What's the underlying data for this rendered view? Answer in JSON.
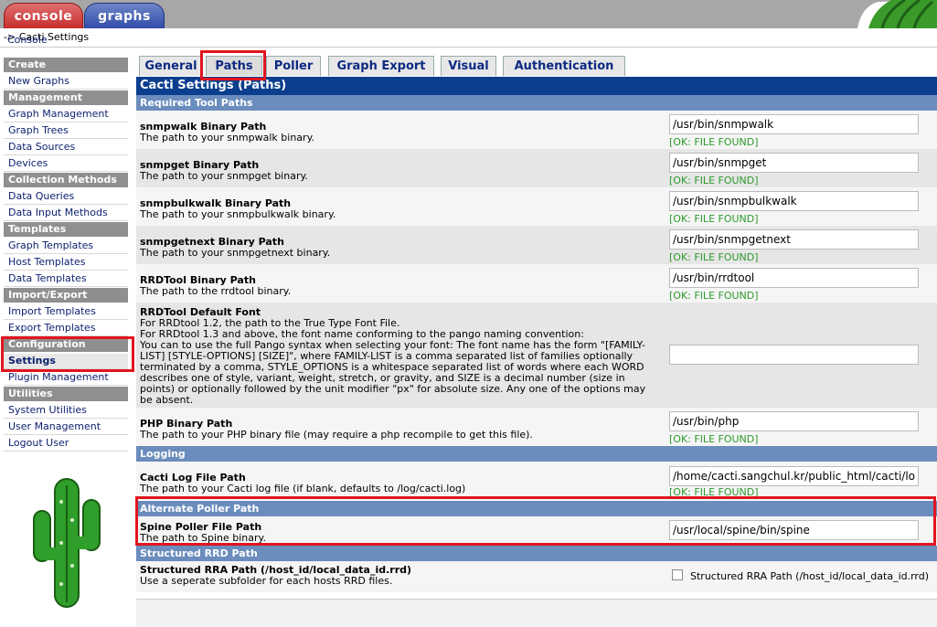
{
  "top_tabs": {
    "console": "console",
    "graphs": "graphs"
  },
  "breadcrumb": {
    "console_link": "Console",
    "separator": " -> ",
    "current": "Cacti Settings"
  },
  "sidebar": {
    "create_head": "Create",
    "new_graphs": "New Graphs",
    "management_head": "Management",
    "graph_management": "Graph Management",
    "graph_trees": "Graph Trees",
    "data_sources": "Data Sources",
    "devices": "Devices",
    "collection_head": "Collection Methods",
    "data_queries": "Data Queries",
    "data_input_methods": "Data Input Methods",
    "templates_head": "Templates",
    "graph_templates": "Graph Templates",
    "host_templates": "Host Templates",
    "data_templates": "Data Templates",
    "import_export_head": "Import/Export",
    "import_templates": "Import Templates",
    "export_templates": "Export Templates",
    "configuration_head": "Configuration",
    "settings": "Settings",
    "plugin_management": "Plugin Management",
    "utilities_head": "Utilities",
    "system_utilities": "System Utilities",
    "user_management": "User Management",
    "logout_user": "Logout User"
  },
  "tabs": {
    "general": "General",
    "paths": "Paths",
    "poller": "Poller",
    "graph_export": "Graph Export",
    "visual": "Visual",
    "authentication": "Authentication"
  },
  "title": "Cacti Settings (Paths)",
  "sections": {
    "required": "Required Tool Paths",
    "logging": "Logging",
    "alternate": "Alternate Poller Path",
    "structured": "Structured RRD Path"
  },
  "ok_text": "[OK: FILE FOUND]",
  "fields": {
    "snmpwalk": {
      "name": "snmpwalk Binary Path",
      "desc": "The path to your snmpwalk binary.",
      "value": "/usr/bin/snmpwalk"
    },
    "snmpget": {
      "name": "snmpget Binary Path",
      "desc": "The path to your snmpget binary.",
      "value": "/usr/bin/snmpget"
    },
    "snmpbulkwalk": {
      "name": "snmpbulkwalk Binary Path",
      "desc": "The path to your snmpbulkwalk binary.",
      "value": "/usr/bin/snmpbulkwalk"
    },
    "snmpgetnext": {
      "name": "snmpgetnext Binary Path",
      "desc": "The path to your snmpgetnext binary.",
      "value": "/usr/bin/snmpgetnext"
    },
    "rrdtool": {
      "name": "RRDTool Binary Path",
      "desc": "The path to the rrdtool binary.",
      "value": "/usr/bin/rrdtool"
    },
    "rrdfont": {
      "name": "RRDTool Default Font",
      "desc1": "For RRDtool 1.2, the path to the True Type Font File.",
      "desc2": "For RRDtool 1.3 and above, the font name conforming to the pango naming convention:",
      "desc3": "You can to use the full Pango syntax when selecting your font: The font name has the form \"[FAMILY-LIST] [STYLE-OPTIONS] [SIZE]\", where FAMILY-LIST is a comma separated list of families optionally terminated by a comma, STYLE_OPTIONS is a whitespace separated list of words where each WORD describes one of style, variant, weight, stretch, or gravity, and SIZE is a decimal number (size in points) or optionally followed by the unit modifier \"px\" for absolute size. Any one of the options may be absent.",
      "value": ""
    },
    "php": {
      "name": "PHP Binary Path",
      "desc": "The path to your PHP binary file (may require a php recompile to get this file).",
      "value": "/usr/bin/php"
    },
    "cactilog": {
      "name": "Cacti Log File Path",
      "desc": "The path to your Cacti log file (if blank, defaults to /log/cacti.log)",
      "value": "/home/cacti.sangchul.kr/public_html/cacti/log/cacti.log"
    },
    "spine": {
      "name": "Spine Poller File Path",
      "desc": "The path to Spine binary.",
      "value": "/usr/local/spine/bin/spine"
    },
    "structured": {
      "name": "Structured RRA Path (/host_id/local_data_id.rrd)",
      "desc": "Use a seperate subfolder for each hosts RRD files.",
      "checkbox_label": "Structured RRA Path (/host_id/local_data_id.rrd)"
    }
  },
  "colors": {
    "title_bar": "#0b3e8d",
    "section_bar": "#6b8dbd",
    "highlight": "#e0151f",
    "ok_green": "#2d9a2d"
  }
}
